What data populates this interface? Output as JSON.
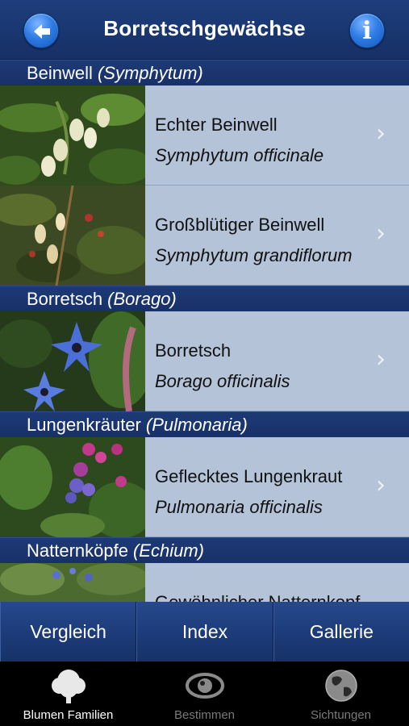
{
  "nav": {
    "title": "Borretschgewächse",
    "info_glyph": "i"
  },
  "sections": [
    {
      "name": "Beinwell",
      "latin": "(Symphytum)"
    },
    {
      "name": "Borretsch",
      "latin": "(Borago)"
    },
    {
      "name": "Lungenkräuter",
      "latin": "(Pulmonaria)"
    },
    {
      "name": "Natternköpfe",
      "latin": "(Echium)"
    }
  ],
  "rows": [
    {
      "name": "Echter Beinwell",
      "latin": "Symphytum officinale",
      "chevron": "›"
    },
    {
      "name": "Großblütiger Beinwell",
      "latin": "Symphytum grandiflorum",
      "chevron": "›"
    },
    {
      "name": "Borretsch",
      "latin": "Borago officinalis",
      "chevron": "›"
    },
    {
      "name": "Geflecktes Lungenkraut",
      "latin": "Pulmonaria officinalis",
      "chevron": "›"
    },
    {
      "name": "Gewöhnlicher Natternkopf",
      "latin": "",
      "chevron": ""
    }
  ],
  "segments": [
    "Vergleich",
    "Index",
    "Gallerie"
  ],
  "tabs": [
    {
      "label": "Blumen Familien",
      "icon": "tree-icon",
      "active": true
    },
    {
      "label": "Bestimmen",
      "icon": "eye-icon",
      "active": false
    },
    {
      "label": "Sichtungen",
      "icon": "globe-icon",
      "active": false
    }
  ],
  "colors": {
    "nav_bg": "#1a3873",
    "row_bg": "#b4c3d8",
    "button_blue": "#2f7de6"
  }
}
